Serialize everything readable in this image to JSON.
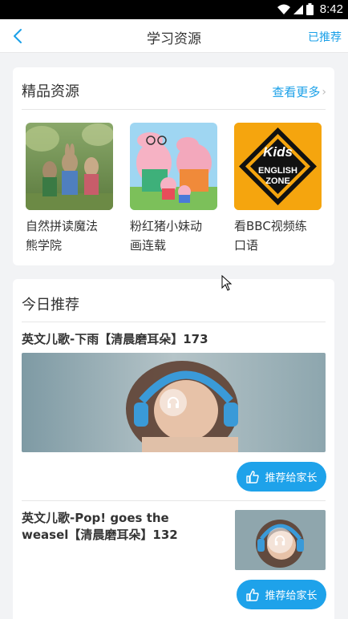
{
  "status_bar": {
    "time": "8:42"
  },
  "header": {
    "back_icon": "chevron-left-icon",
    "title": "学习资源",
    "right_action": "已推荐"
  },
  "featured": {
    "title": "精品资源",
    "more_label": "查看更多",
    "items": [
      {
        "label_line1": "自然拼读魔法",
        "label_line2": "熊学院"
      },
      {
        "label_line1": "粉红猪小妹动",
        "label_line2": "画连载"
      },
      {
        "label_line1": "看BBC视频练",
        "label_line2": "口语",
        "badge_text_1": "Kids",
        "badge_text_2": "ENGLISH",
        "badge_text_3": "ZONE"
      }
    ]
  },
  "today": {
    "title": "今日推荐",
    "songs": [
      {
        "title": "英文儿歌-下雨【清晨磨耳朵】173",
        "button_label": "推荐给家长"
      },
      {
        "title_line1": "英文儿歌-Pop! goes the",
        "title_line2": "weasel【清晨磨耳朵】132",
        "button_label": "推荐给家长"
      }
    ]
  },
  "colors": {
    "accent": "#1aa0e8",
    "button": "#1ea2ea",
    "background": "#f2f3f5"
  }
}
